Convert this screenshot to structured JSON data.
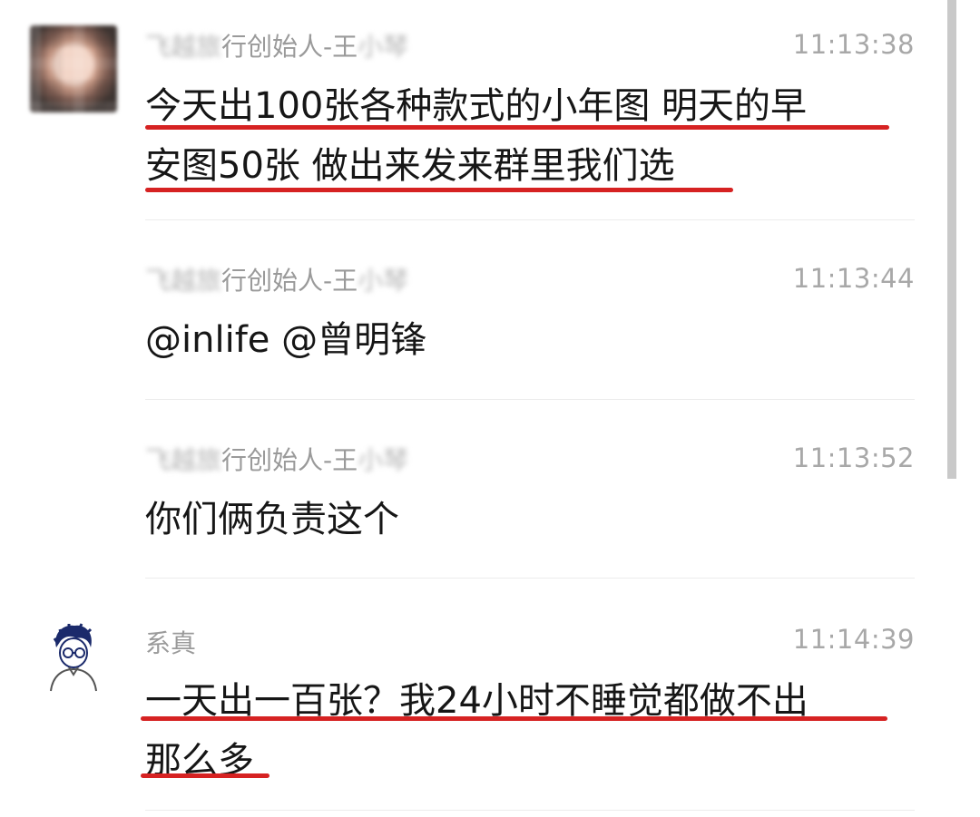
{
  "messages": [
    {
      "sender_blurred": "飞越旅",
      "sender_mid": "行创始人-王",
      "sender_tail": "小琴",
      "time": "11:13:38",
      "lines": [
        "今天出100张各种款式的小年图 明天的早",
        "安图50张 做出来发来群里我们选"
      ]
    },
    {
      "sender_blurred": "飞越旅",
      "sender_mid": "行创始人-王",
      "sender_tail": "小琴",
      "time": "11:13:44",
      "lines": [
        "@inlife @曾明锋"
      ]
    },
    {
      "sender_blurred": "飞越旅",
      "sender_mid": "行创始人-王",
      "sender_tail": "小琴",
      "time": "11:13:52",
      "lines": [
        "你们俩负责这个"
      ]
    },
    {
      "sender": "系真",
      "time": "11:14:39",
      "lines": [
        "一天出一百张？我24小时不睡觉都做不出",
        "那么多"
      ]
    }
  ],
  "colors": {
    "underline": "#d62222",
    "timestamp": "#a8a8a8",
    "sender": "#9a9a9a"
  }
}
